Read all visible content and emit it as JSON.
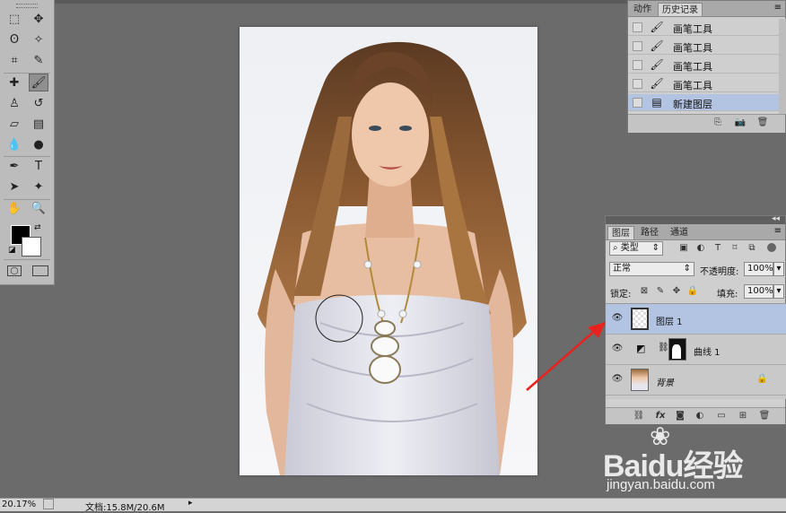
{
  "toolbox": {
    "tools": [
      {
        "name": "marquee-tool",
        "glyph": "⬚"
      },
      {
        "name": "move-tool",
        "glyph": "✥"
      },
      {
        "name": "lasso-tool",
        "glyph": "ʘ"
      },
      {
        "name": "magic-wand-tool",
        "glyph": "✧"
      },
      {
        "name": "crop-tool",
        "glyph": "⌗"
      },
      {
        "name": "eyedropper-tool",
        "glyph": "✎"
      },
      {
        "name": "healing-brush-tool",
        "glyph": "✚"
      },
      {
        "name": "brush-tool",
        "glyph": "🖌"
      },
      {
        "name": "clone-stamp-tool",
        "glyph": "♙"
      },
      {
        "name": "history-brush-tool",
        "glyph": "↺"
      },
      {
        "name": "eraser-tool",
        "glyph": "▱"
      },
      {
        "name": "gradient-tool",
        "glyph": "▤"
      },
      {
        "name": "blur-tool",
        "glyph": "💧"
      },
      {
        "name": "dodge-tool",
        "glyph": "●"
      },
      {
        "name": "pen-tool",
        "glyph": "✒"
      },
      {
        "name": "type-tool",
        "glyph": "T"
      },
      {
        "name": "path-selection-tool",
        "glyph": "➤"
      },
      {
        "name": "shape-tool",
        "glyph": "✦"
      },
      {
        "name": "hand-tool",
        "glyph": "✋"
      },
      {
        "name": "zoom-tool",
        "glyph": "🔍"
      }
    ],
    "active_tool": "brush-tool",
    "foreground_color": "#000000",
    "background_color": "#ffffff"
  },
  "status_bar": {
    "zoom": "20.17%",
    "doc_info": "文档:15.8M/20.6M"
  },
  "history_panel": {
    "tabs": [
      "动作",
      "历史记录"
    ],
    "active_tab": "历史记录",
    "rows": [
      {
        "label": "画笔工具",
        "icon": "brush-icon"
      },
      {
        "label": "画笔工具",
        "icon": "brush-icon"
      },
      {
        "label": "画笔工具",
        "icon": "brush-icon"
      },
      {
        "label": "画笔工具",
        "icon": "brush-icon"
      },
      {
        "label": "新建图层",
        "icon": "new-layer-icon",
        "selected": true
      }
    ]
  },
  "layers_panel": {
    "tabs": [
      "图层",
      "路径",
      "通道"
    ],
    "active_tab": "图层",
    "filter_kind": "类型",
    "blend_mode": "正常",
    "opacity_label": "不透明度:",
    "opacity_value": "100%",
    "lock_label": "锁定:",
    "fill_label": "填充:",
    "fill_value": "100%",
    "layers": [
      {
        "name": "图层 1",
        "selected": true
      },
      {
        "name": "曲线 1",
        "selected": false
      },
      {
        "name": "背景",
        "selected": false,
        "locked": true
      }
    ]
  },
  "watermark": {
    "brand": "Baidu经验",
    "url": "jingyan.baidu.com"
  },
  "colors": {
    "workspace": "#6b6b6b",
    "panel": "#cfcfcf",
    "selection": "#b3c4e3",
    "arrow": "#e8231f"
  }
}
